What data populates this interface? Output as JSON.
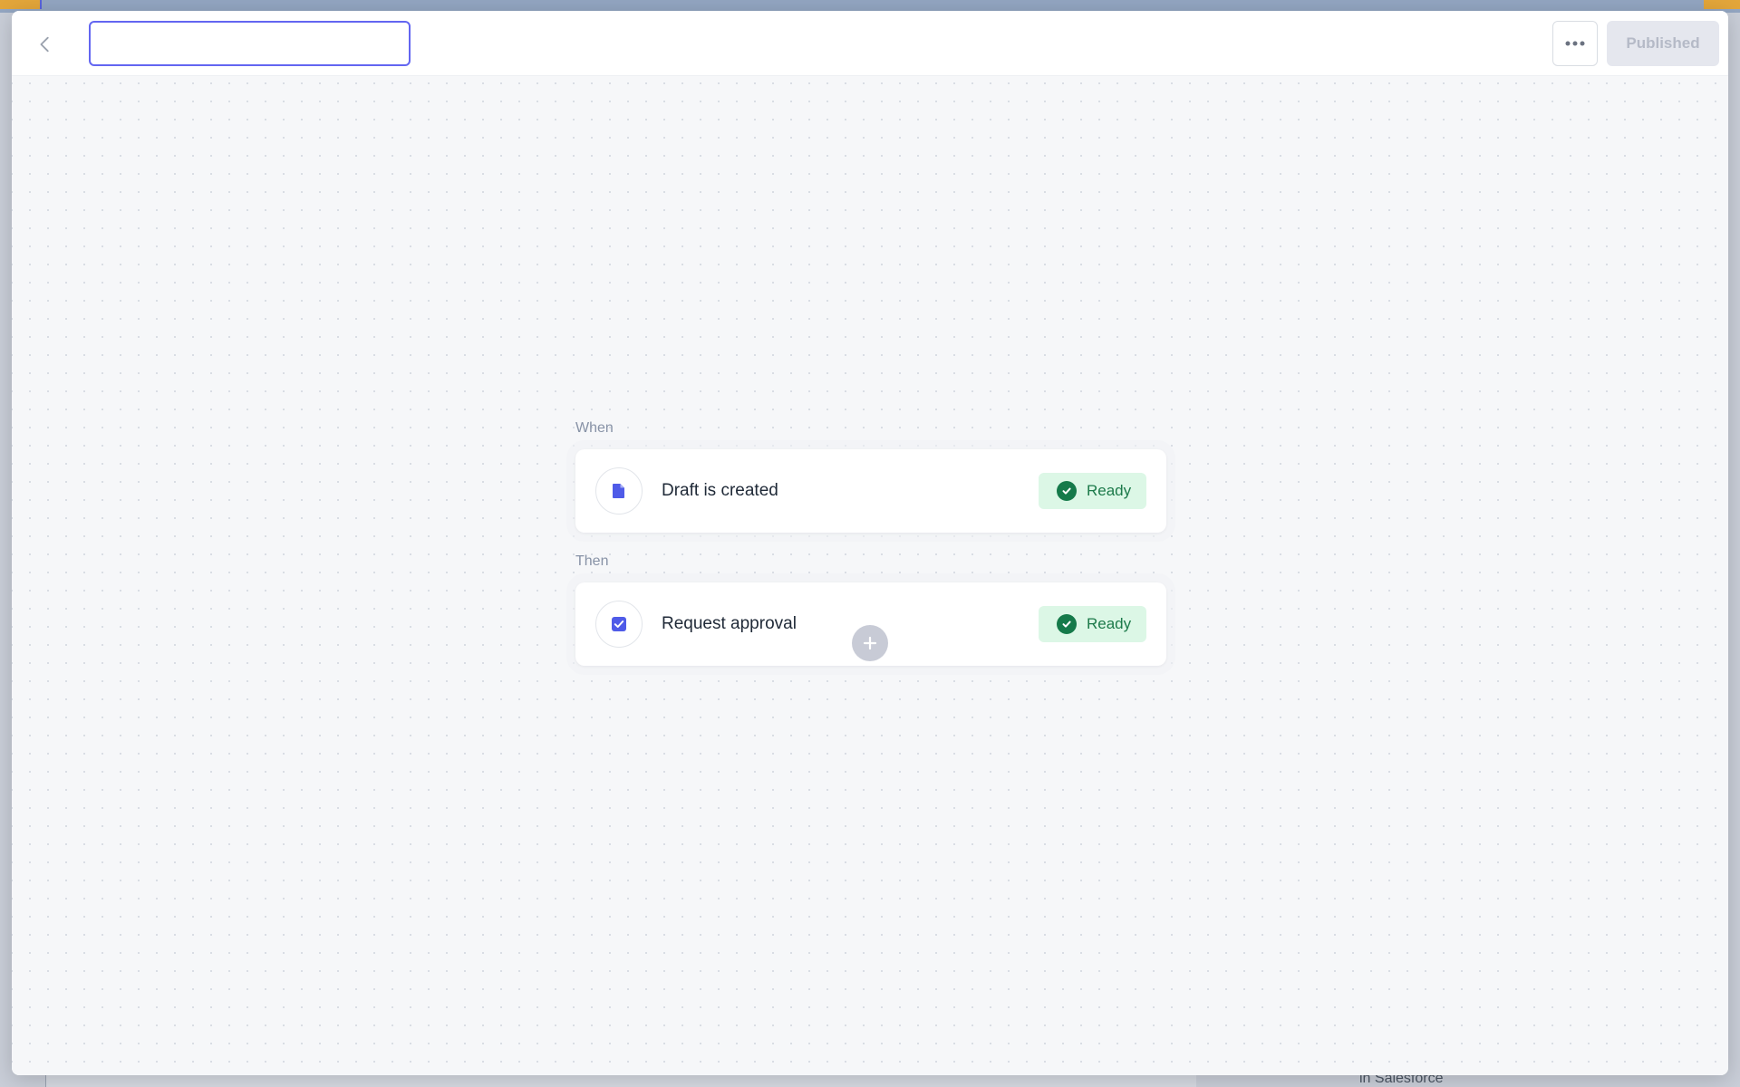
{
  "backdrop": {
    "bottom_text": "in Salesforce"
  },
  "header": {
    "name_input": {
      "value": "",
      "placeholder": ""
    },
    "more_icon": "more-horizontal-icon",
    "publish_label": "Published"
  },
  "workflow": {
    "trigger_section_label": "When",
    "action_section_label": "Then",
    "steps": [
      {
        "icon": "document-icon",
        "title": "Draft is created",
        "status": "Ready"
      },
      {
        "icon": "checkbox-icon",
        "title": "Request approval",
        "status": "Ready"
      }
    ],
    "add_icon": "plus-icon"
  },
  "colors": {
    "accent": "#4f5be8",
    "status_bg": "#dcf7e6",
    "status_text": "#1c7a4a",
    "status_icon": "#157a4a"
  }
}
